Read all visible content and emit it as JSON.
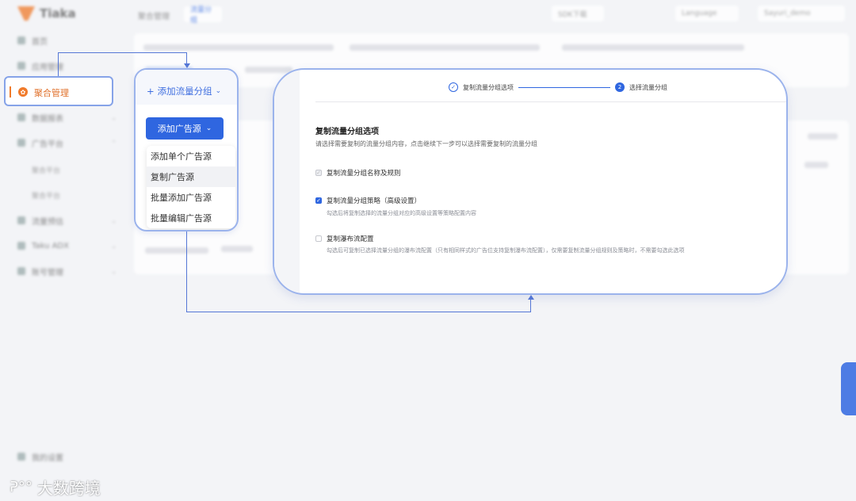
{
  "app": {
    "logo_text": "Tiaka",
    "brand_color": "#f07a2a",
    "accent": "#2f66e0"
  },
  "sidebar": {
    "items": [
      {
        "label": "首页"
      },
      {
        "label": "应用管理"
      },
      {
        "label": "聚合管理"
      },
      {
        "label": "数据报表"
      },
      {
        "label": "广告平台"
      },
      {
        "label": "流量预估"
      },
      {
        "label": "Taku ADX"
      },
      {
        "label": "账号管理"
      }
    ],
    "sub_items": [
      {
        "label": "聚合平台"
      },
      {
        "label": "聚合平台"
      }
    ],
    "bottom_item": {
      "label": "我的设置"
    }
  },
  "topbar": {
    "title": "聚合管理",
    "tag": "流量分组",
    "docs": "SDK下载",
    "language": "Language",
    "user": "Sayuri_demo"
  },
  "popup": {
    "add_group_label": "添加流量分组",
    "primary_button": "添加广告源",
    "menu": [
      "添加单个广告源",
      "复制广告源",
      "批量添加广告源",
      "批量编辑广告源"
    ]
  },
  "modal": {
    "steps": [
      {
        "label": "复制流量分组选项",
        "state": "done"
      },
      {
        "label": "选择流量分组",
        "state": "current",
        "index": "2"
      }
    ],
    "section_title": "复制流量分组选项",
    "section_desc": "请选择需要复制的流量分组内容，点击继续下一步可以选择需要复制的流量分组",
    "options": [
      {
        "label": "复制流量分组名称及规则",
        "checked": true,
        "disabled": true,
        "hint": ""
      },
      {
        "label": "复制流量分组策略（高级设置）",
        "checked": true,
        "disabled": false,
        "hint": "勾选后将复制选择的流量分组对应的高级设置等策略配置内容"
      },
      {
        "label": "复制瀑布流配置",
        "checked": false,
        "disabled": false,
        "hint": "勾选后可复制已选择流量分组的瀑布流配置（只有相同样式的广告位支持复制瀑布流配置），仅需要复制流量分组规则及策略时，不需要勾选此选项"
      }
    ]
  },
  "watermark": "大数跨境"
}
